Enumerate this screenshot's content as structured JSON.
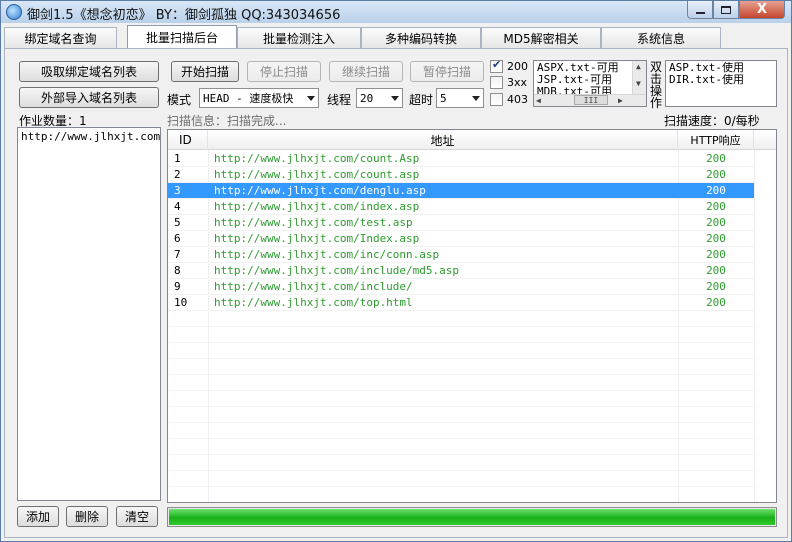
{
  "window": {
    "title": "御剑1.5《想念初恋》 BY：御剑孤独 QQ:343034656",
    "controls": {
      "minimize": "minimize",
      "maximize": "maximize",
      "close": "X"
    }
  },
  "tabs": [
    {
      "label": "绑定域名查询",
      "active": false
    },
    {
      "label": "批量扫描后台",
      "active": true
    },
    {
      "label": "批量检测注入",
      "active": false
    },
    {
      "label": "多种编码转换",
      "active": false
    },
    {
      "label": "MD5解密相关",
      "active": false
    },
    {
      "label": "系统信息",
      "active": false
    }
  ],
  "left": {
    "absorb_button": "吸取绑定域名列表",
    "import_button": "外部导入域名列表",
    "job_count_label": "作业数量：1",
    "domains": [
      "http://www.jlhxjt.com"
    ],
    "add_button": "添加",
    "delete_button": "删除",
    "clear_button": "清空"
  },
  "toolbar": {
    "start": "开始扫描",
    "stop": "停止扫描",
    "resume": "继续扫描",
    "pause": "暂停扫描",
    "mode_label": "模式",
    "mode_value": "HEAD - 速度极快",
    "threads_label": "线程",
    "threads_value": "20",
    "timeout_label": "超时",
    "timeout_value": "5"
  },
  "status_filters": [
    {
      "label": "200",
      "checked": true
    },
    {
      "label": "3xx",
      "checked": false
    },
    {
      "label": "403",
      "checked": false
    }
  ],
  "dictionaries": {
    "left_list": [
      "ASPX.txt-可用",
      "JSP.txt-可用",
      "MDB.txt-可用"
    ],
    "double_click_hint": [
      "双",
      "击",
      "操",
      "作"
    ],
    "right_list": [
      "ASP.txt-使用",
      "DIR.txt-使用"
    ],
    "scroll_thumb_glyph": "III",
    "arrow_up": "▲",
    "arrow_down": "▼",
    "arrow_left": "◀",
    "arrow_right": "▶"
  },
  "scan": {
    "info": "扫描信息：扫描完成...",
    "speed": "扫描速度：0/每秒",
    "progress_percent": 100
  },
  "results": {
    "columns": [
      "ID",
      "地址",
      "HTTP响应"
    ],
    "rows": [
      {
        "id": "1",
        "url": "http://www.jlhxjt.com/count.Asp",
        "code": "200"
      },
      {
        "id": "2",
        "url": "http://www.jlhxjt.com/count.asp",
        "code": "200"
      },
      {
        "id": "3",
        "url": "http://www.jlhxjt.com/denglu.asp",
        "code": "200"
      },
      {
        "id": "4",
        "url": "http://www.jlhxjt.com/index.asp",
        "code": "200"
      },
      {
        "id": "5",
        "url": "http://www.jlhxjt.com/test.asp",
        "code": "200"
      },
      {
        "id": "6",
        "url": "http://www.jlhxjt.com/Index.asp",
        "code": "200"
      },
      {
        "id": "7",
        "url": "http://www.jlhxjt.com/inc/conn.asp",
        "code": "200"
      },
      {
        "id": "8",
        "url": "http://www.jlhxjt.com/include/md5.asp",
        "code": "200"
      },
      {
        "id": "9",
        "url": "http://www.jlhxjt.com/include/",
        "code": "200"
      },
      {
        "id": "10",
        "url": "http://www.jlhxjt.com/top.html",
        "code": "200"
      }
    ],
    "selected_index": 2
  },
  "colors": {
    "url_green": "#2e9c2e",
    "selection_blue": "#3399ff",
    "progress_green": "#19b219"
  }
}
